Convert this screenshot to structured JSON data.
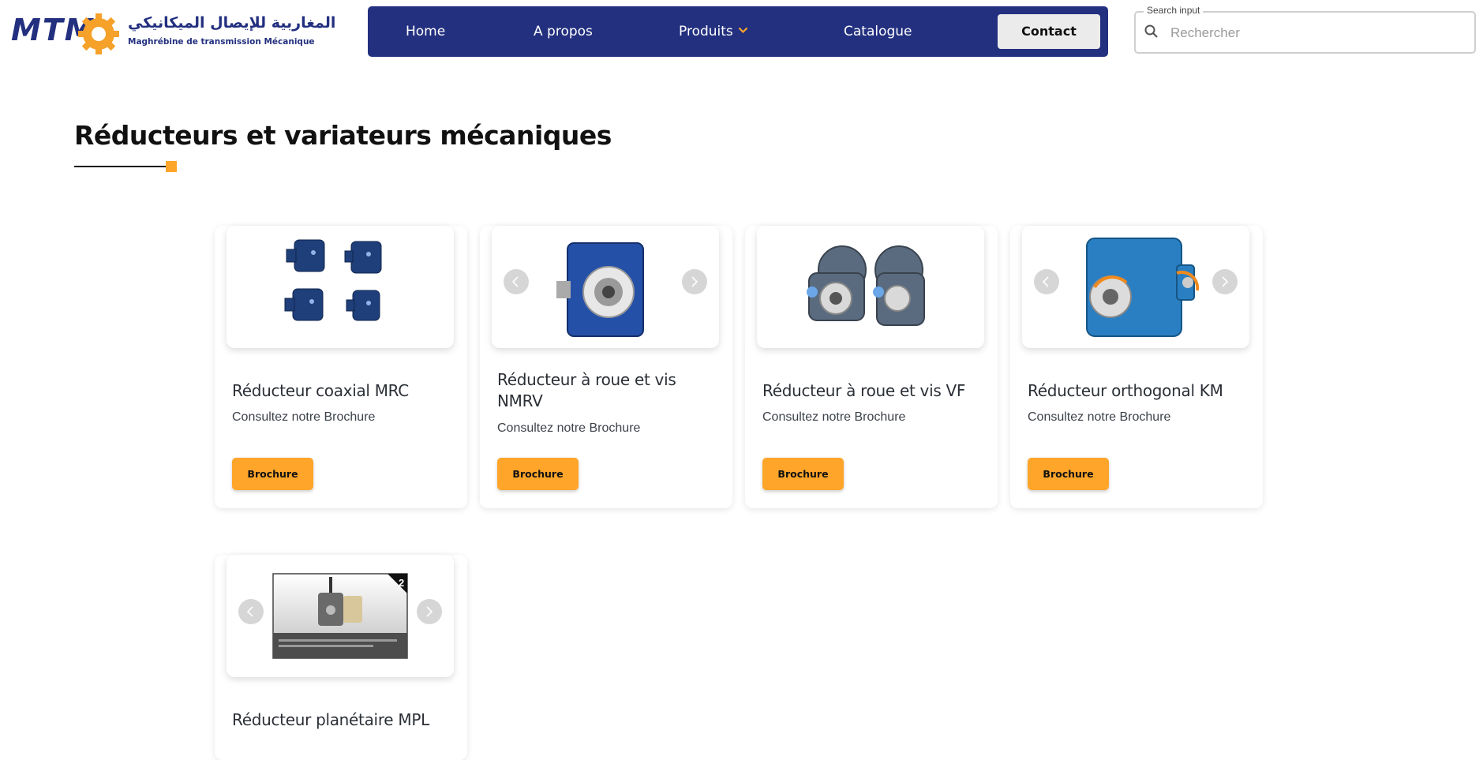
{
  "brand": {
    "logo_mark": "MTM",
    "arabic_name": "المغاربية للإيصال الميكانيكي",
    "french_name": "Maghrébine de transmission Mécanique",
    "color_primary": "#23307f",
    "color_accent": "#ffa52a"
  },
  "nav": {
    "home": "Home",
    "apropos": "A propos",
    "produits": "Produits",
    "catalogue": "Catalogue",
    "contact": "Contact"
  },
  "search": {
    "label": "Search input",
    "placeholder": "Rechercher"
  },
  "page": {
    "title": "Réducteurs et variateurs mécaniques"
  },
  "products": [
    {
      "title": "Réducteur coaxial MRC",
      "subtitle": "Consultez notre Brochure",
      "button": "Brochure",
      "image_icon": "coaxial-reducer-image"
    },
    {
      "title": "Réducteur à roue et vis NMRV",
      "subtitle": "Consultez notre Brochure",
      "button": "Brochure",
      "image_icon": "worm-reducer-nmrv-image"
    },
    {
      "title": "Réducteur à roue et vis VF",
      "subtitle": "Consultez notre Brochure",
      "button": "Brochure",
      "image_icon": "worm-reducer-vf-image"
    },
    {
      "title": "Réducteur orthogonal KM",
      "subtitle": "Consultez notre Brochure",
      "button": "Brochure",
      "image_icon": "orthogonal-reducer-image"
    },
    {
      "title": "Réducteur planétaire MPL",
      "image_icon": "planetary-reducer-image",
      "slide_number": "2"
    }
  ]
}
